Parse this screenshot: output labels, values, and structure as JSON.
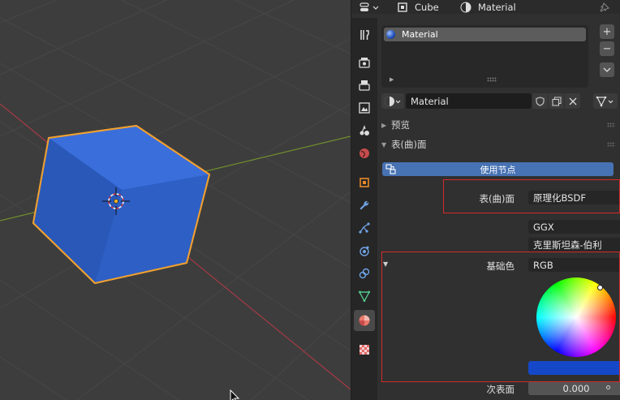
{
  "header": {
    "object_name": "Cube",
    "material_name": "Material"
  },
  "material_slots": {
    "items": [
      {
        "label": "Material"
      }
    ],
    "add_icon": "plus",
    "remove_icon": "minus",
    "more_icon": "chevron-down"
  },
  "material_selector": {
    "name": "Material"
  },
  "panels": {
    "preview": "预览",
    "surface": "表(曲)面"
  },
  "surface": {
    "use_nodes_label": "使用节点",
    "surface_label": "表(曲)面",
    "surface_value": "原理化BSDF",
    "distribution_value": "GGX",
    "subsurface_method_value": "克里斯坦森-伯利",
    "base_color_label": "基础色",
    "base_color_mode": "RGB",
    "base_color_hex": "#1548C8",
    "subsurface_label": "次表面",
    "subsurface_value": "0.000"
  },
  "colors": {
    "accent": "#4772b3",
    "highlight_box": "#d42a2a",
    "selection_outline": "#f0a030",
    "cube_face": "#2f62c8"
  }
}
